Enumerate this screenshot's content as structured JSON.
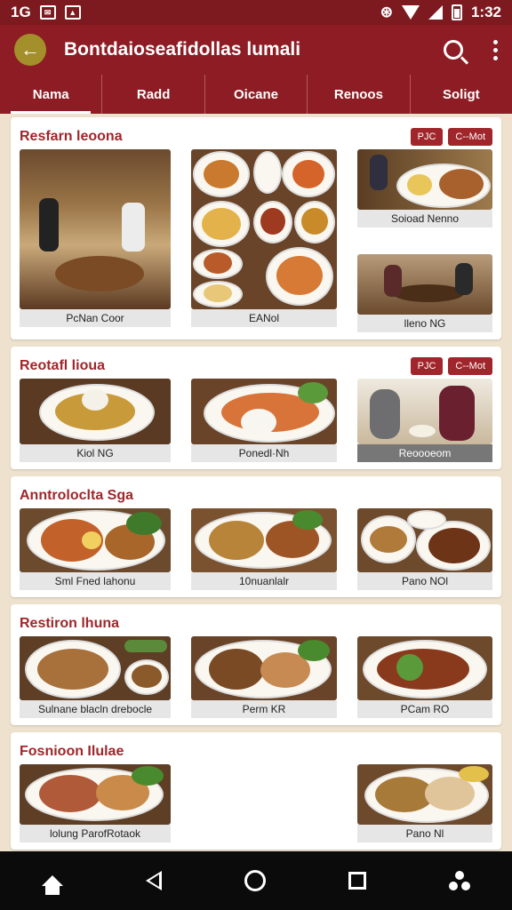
{
  "status_bar": {
    "left_text": "1G",
    "time": "1:32"
  },
  "app_bar": {
    "title": "Bontdaioseafidollas lumali"
  },
  "tabs": [
    {
      "label": "Nama",
      "active": true
    },
    {
      "label": "Radd",
      "active": false
    },
    {
      "label": "Oicane",
      "active": false
    },
    {
      "label": "Renoos",
      "active": false
    },
    {
      "label": "Soligt",
      "active": false
    }
  ],
  "sections": [
    {
      "title": "Resfarn leoona",
      "badges": [
        "PJC",
        "C--Mot"
      ],
      "items": [
        "PcNan Coor",
        "EANol",
        "Soioad Nenno",
        "lleno NG"
      ]
    },
    {
      "title": "Reotafl lioua",
      "badges": [
        "PJC",
        "C--Mot"
      ],
      "items": [
        "Kiol NG",
        "Ponedl·Nh",
        "Reoooeom"
      ]
    },
    {
      "title": "Anntroloclta Sga",
      "items": [
        "Sml Fned lahonu",
        "10nuanlalr",
        "Pano NOl"
      ]
    },
    {
      "title": "Restiron lhuna",
      "items": [
        "Sulnane blacln drebocle",
        "Perm KR",
        "PCam RO"
      ]
    },
    {
      "title": "Fosnioon Ilulae",
      "items": [
        "lolung ParofRotaok",
        "Pano Nl"
      ]
    }
  ],
  "colors": {
    "primary": "#8d1c24",
    "accent": "#a0262b",
    "background": "#eee2cf"
  }
}
